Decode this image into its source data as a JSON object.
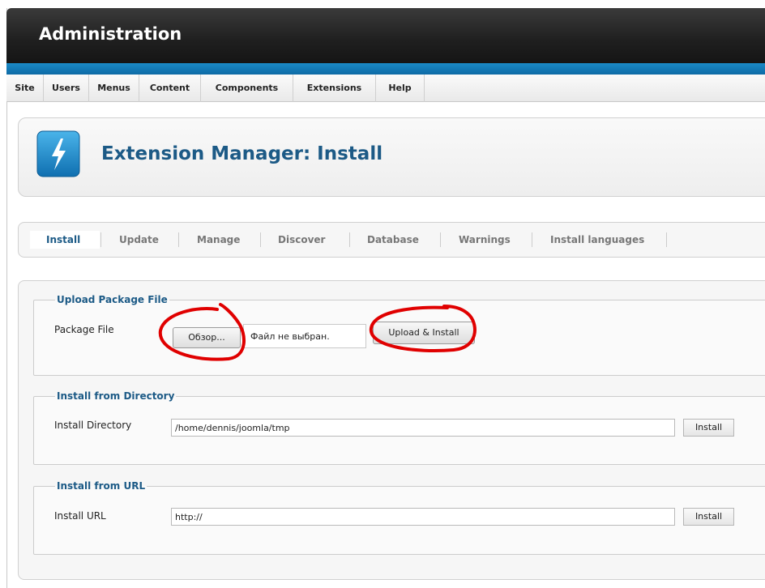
{
  "header": {
    "title": "Administration"
  },
  "menu": {
    "items": [
      "Site",
      "Users",
      "Menus",
      "Content",
      "Components",
      "Extensions",
      "Help"
    ]
  },
  "toolbar": {
    "page_title": "Extension Manager: Install",
    "icon": "lightning-bolt-icon"
  },
  "subnav": {
    "tabs": [
      "Install",
      "Update",
      "Manage",
      "Discover",
      "Database",
      "Warnings",
      "Install languages"
    ],
    "active": "Install"
  },
  "upload": {
    "legend": "Upload Package File",
    "label": "Package File",
    "browse_button": "Обзор...",
    "file_status": "Файл не выбран.",
    "submit_button": "Upload & Install"
  },
  "directory": {
    "legend": "Install from Directory",
    "label": "Install Directory",
    "value": "/home/dennis/joomla/tmp",
    "button": "Install"
  },
  "url": {
    "legend": "Install from URL",
    "label": "Install URL",
    "value": "http://",
    "button": "Install"
  },
  "colors": {
    "accent": "#1c5a86",
    "header_blue": "#1a8ac7",
    "annotation_red": "#e00000"
  }
}
